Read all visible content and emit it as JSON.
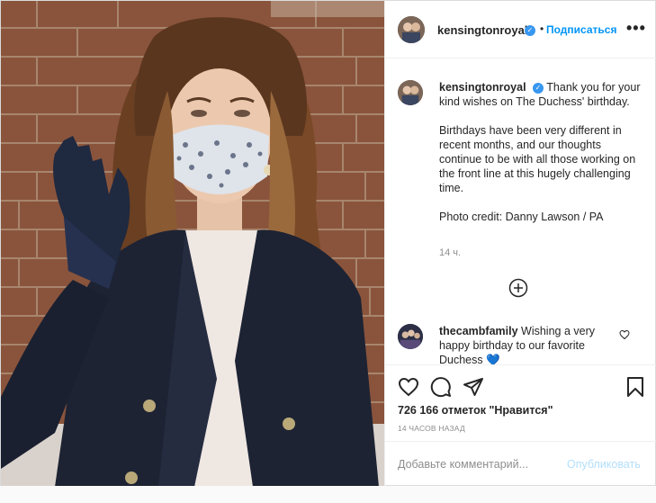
{
  "post": {
    "username": "kensingtonroyal",
    "verified_mark": "✓",
    "separator": "•",
    "follow_label": "Подписаться",
    "more_label": "•••",
    "caption": {
      "username": "kensingtonroyal",
      "line1": "Thank you for your kind wishes on The Duchess' birthday.",
      "line2": "Birthdays have been very different in recent months, and our thoughts continue to be with all those working on the front line at this hugely challenging time.",
      "line3": "Photo credit: Danny Lawson / PA",
      "time": "14 ч."
    },
    "comment": {
      "username": "thecambfamily",
      "text": "Wishing a very happy birthday to our favorite Duchess",
      "emoji_hint": "💙"
    },
    "likes": "726 166 отметок \"Нравится\"",
    "posted_ago": "14 ЧАСОВ НАЗАД",
    "add_comment_placeholder": "Добавьте комментарий...",
    "publish_label": "Опубликовать"
  },
  "icons": {
    "header_more": "more-dots-icon",
    "load_more": "plus-circle-icon",
    "comment_like": "heart-icon",
    "like": "heart-icon",
    "comment": "comment-bubble-icon",
    "share": "paper-plane-icon",
    "save": "bookmark-icon"
  },
  "colors": {
    "accent": "#0095f6",
    "verified": "#3897f0",
    "muted": "#8e8e8e",
    "border": "#dbdbdb",
    "publish_disabled": "#b2dffc"
  }
}
